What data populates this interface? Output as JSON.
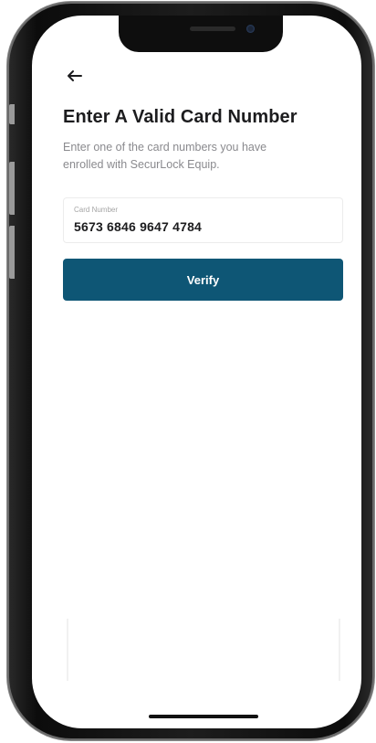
{
  "screen": {
    "title": "Enter A Valid Card Number",
    "subtitle": "Enter one of the card numbers you have enrolled with SecurLock Equip.",
    "card_field": {
      "label": "Card Number",
      "value": "5673 6846 9647 4784"
    },
    "verify_label": "Verify"
  },
  "icons": {
    "back": "arrow-left-icon"
  },
  "colors": {
    "primary": "#0e5675",
    "title_text": "#1c1c1e",
    "subtitle_text": "#8a8a8e",
    "field_border": "#ececec"
  }
}
